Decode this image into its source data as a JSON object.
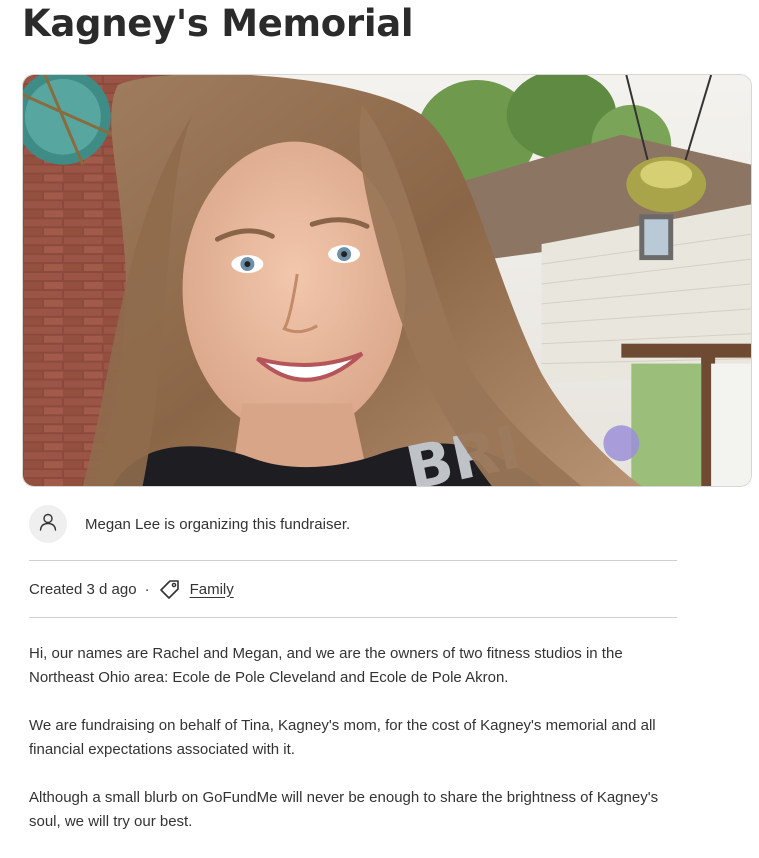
{
  "page": {
    "title": "Kagney's Memorial"
  },
  "hero_image": {
    "alt": "Selfie of a smiling woman with long light-brown hair wearing a black t-shirt, on a porch with a brick wall and a house behind her"
  },
  "organizer": {
    "text": "Megan Lee is organizing this fundraiser.",
    "icon": "person-icon"
  },
  "meta": {
    "created": "Created 3 d ago",
    "separator": "·",
    "category_icon": "tag-icon",
    "category": "Family"
  },
  "story": {
    "paragraphs": [
      "Hi, our names are Rachel and Megan, and we are the owners of two fitness studios in the Northeast Ohio area: Ecole de Pole Cleveland and Ecole de Pole Akron.",
      "We are fundraising on behalf of Tina, Kagney's mom, for the cost of Kagney's memorial and all financial expectations associated with it.",
      "Although a small blurb on GoFundMe will never be enough to share the brightness of Kagney's soul, we will try our best."
    ]
  }
}
